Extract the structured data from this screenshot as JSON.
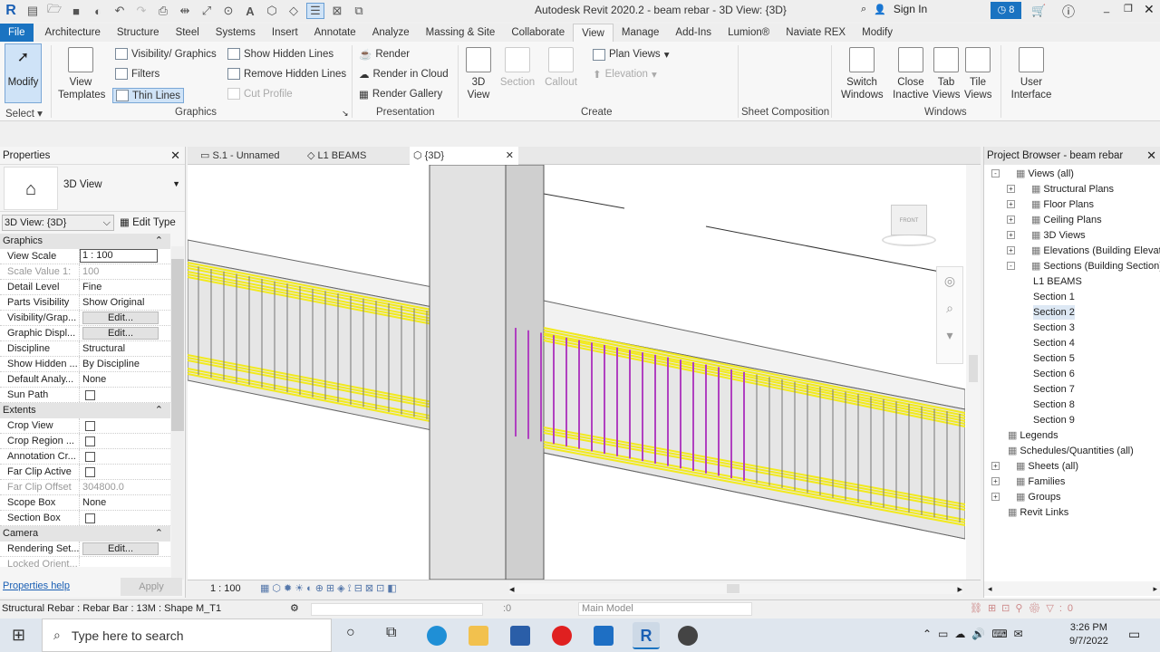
{
  "app_title": "Autodesk Revit 2020.2 - beam rebar - 3D View: {3D}",
  "sign_in": "Sign In",
  "notifications": "8",
  "tabs": [
    "File",
    "Architecture",
    "Structure",
    "Steel",
    "Systems",
    "Insert",
    "Annotate",
    "Analyze",
    "Massing & Site",
    "Collaborate",
    "View",
    "Manage",
    "Add-Ins",
    "Lumion®",
    "Naviate REX",
    "Modify"
  ],
  "active_tab": "View",
  "ribbon": {
    "modify": "Modify",
    "select": "Select",
    "view_templates_1": "View",
    "view_templates_2": "Templates",
    "visibility_graphics": "Visibility/ Graphics",
    "filters": "Filters",
    "thin_lines": "Thin Lines",
    "show_hidden": "Show Hidden Lines",
    "remove_hidden": "Remove Hidden Lines",
    "cut_profile": "Cut Profile",
    "graphics": "Graphics",
    "render": "Render",
    "render_cloud": "Render in Cloud",
    "render_gallery": "Render Gallery",
    "presentation": "Presentation",
    "view3d_1": "3D",
    "view3d_2": "View",
    "section": "Section",
    "callout": "Callout",
    "plan_views": "Plan Views",
    "elevation": "Elevation",
    "create": "Create",
    "sheet_composition": "Sheet Composition",
    "switch_1": "Switch",
    "switch_2": "Windows",
    "close_1": "Close",
    "close_2": "Inactive",
    "tab_1": "Tab",
    "tab_2": "Views",
    "tile_1": "Tile",
    "tile_2": "Views",
    "ui_1": "User",
    "ui_2": "Interface",
    "windows": "Windows"
  },
  "properties": {
    "title": "Properties",
    "type": "3D View",
    "view_selector": "3D View: {3D}",
    "edit_type": "Edit Type",
    "sections": [
      {
        "name": "Graphics",
        "rows": [
          {
            "k": "View Scale",
            "v": "1 : 100",
            "kind": "input"
          },
          {
            "k": "Scale Value    1:",
            "v": "100",
            "kind": "grey"
          },
          {
            "k": "Detail Level",
            "v": "Fine"
          },
          {
            "k": "Parts Visibility",
            "v": "Show Original"
          },
          {
            "k": "Visibility/Grap...",
            "v": "Edit...",
            "kind": "button"
          },
          {
            "k": "Graphic Displ...",
            "v": "Edit...",
            "kind": "button"
          },
          {
            "k": "Discipline",
            "v": "Structural"
          },
          {
            "k": "Show Hidden ...",
            "v": "By Discipline"
          },
          {
            "k": "Default Analy...",
            "v": "None"
          },
          {
            "k": "Sun Path",
            "v": "",
            "kind": "check"
          }
        ]
      },
      {
        "name": "Extents",
        "rows": [
          {
            "k": "Crop View",
            "v": "",
            "kind": "check"
          },
          {
            "k": "Crop Region ...",
            "v": "",
            "kind": "check"
          },
          {
            "k": "Annotation Cr...",
            "v": "",
            "kind": "check"
          },
          {
            "k": "Far Clip Active",
            "v": "",
            "kind": "check"
          },
          {
            "k": "Far Clip Offset",
            "v": "304800.0",
            "kind": "grey"
          },
          {
            "k": "Scope Box",
            "v": "None"
          },
          {
            "k": "Section Box",
            "v": "",
            "kind": "check"
          }
        ]
      },
      {
        "name": "Camera",
        "rows": [
          {
            "k": "Rendering Set...",
            "v": "Edit...",
            "kind": "button"
          },
          {
            "k": "Locked Orient...",
            "v": "",
            "kind": "grey"
          }
        ]
      }
    ],
    "help": "Properties help",
    "apply": "Apply"
  },
  "view_tabs": [
    "S.1 - Unnamed",
    "L1 BEAMS",
    "{3D}"
  ],
  "view_scale": "1 : 100",
  "viewcube_label": "FRONT",
  "browser": {
    "title": "Project Browser - beam rebar",
    "items": [
      {
        "t": "Views (all)",
        "lvl": 0,
        "pm": "-"
      },
      {
        "t": "Structural Plans",
        "lvl": 1,
        "pm": "+"
      },
      {
        "t": "Floor Plans",
        "lvl": 1,
        "pm": "+"
      },
      {
        "t": "Ceiling Plans",
        "lvl": 1,
        "pm": "+"
      },
      {
        "t": "3D Views",
        "lvl": 1,
        "pm": "+"
      },
      {
        "t": "Elevations (Building Elevation",
        "lvl": 1,
        "pm": "+"
      },
      {
        "t": "Sections (Building Section)",
        "lvl": 1,
        "pm": "-"
      },
      {
        "t": "L1 BEAMS",
        "lvl": 2
      },
      {
        "t": "Section 1",
        "lvl": 2
      },
      {
        "t": "Section 2",
        "lvl": 2,
        "sel": true
      },
      {
        "t": "Section 3",
        "lvl": 2
      },
      {
        "t": "Section 4",
        "lvl": 2
      },
      {
        "t": "Section 5",
        "lvl": 2
      },
      {
        "t": "Section 6",
        "lvl": 2
      },
      {
        "t": "Section 7",
        "lvl": 2
      },
      {
        "t": "Section 8",
        "lvl": 2
      },
      {
        "t": "Section 9",
        "lvl": 2
      },
      {
        "t": "Legends",
        "lvl": 0,
        "icon": true
      },
      {
        "t": "Schedules/Quantities (all)",
        "lvl": 0,
        "icon": true
      },
      {
        "t": "Sheets (all)",
        "lvl": 0,
        "pm": "+"
      },
      {
        "t": "Families",
        "lvl": 0,
        "pm": "+"
      },
      {
        "t": "Groups",
        "lvl": 0,
        "pm": "+"
      },
      {
        "t": "Revit Links",
        "lvl": 0,
        "icon": true
      }
    ]
  },
  "status": {
    "text": "Structural Rebar : Rebar Bar : 13M : Shape M_T1",
    "count": ":0",
    "model": "Main Model"
  },
  "taskbar": {
    "search": "Type here to search",
    "time": "3:26 PM",
    "date": "9/7/2022"
  },
  "colors": {
    "file_tab": "#1a73c1",
    "rebar": "#f2ea1c",
    "stirrup_selected": "#b040c0"
  }
}
